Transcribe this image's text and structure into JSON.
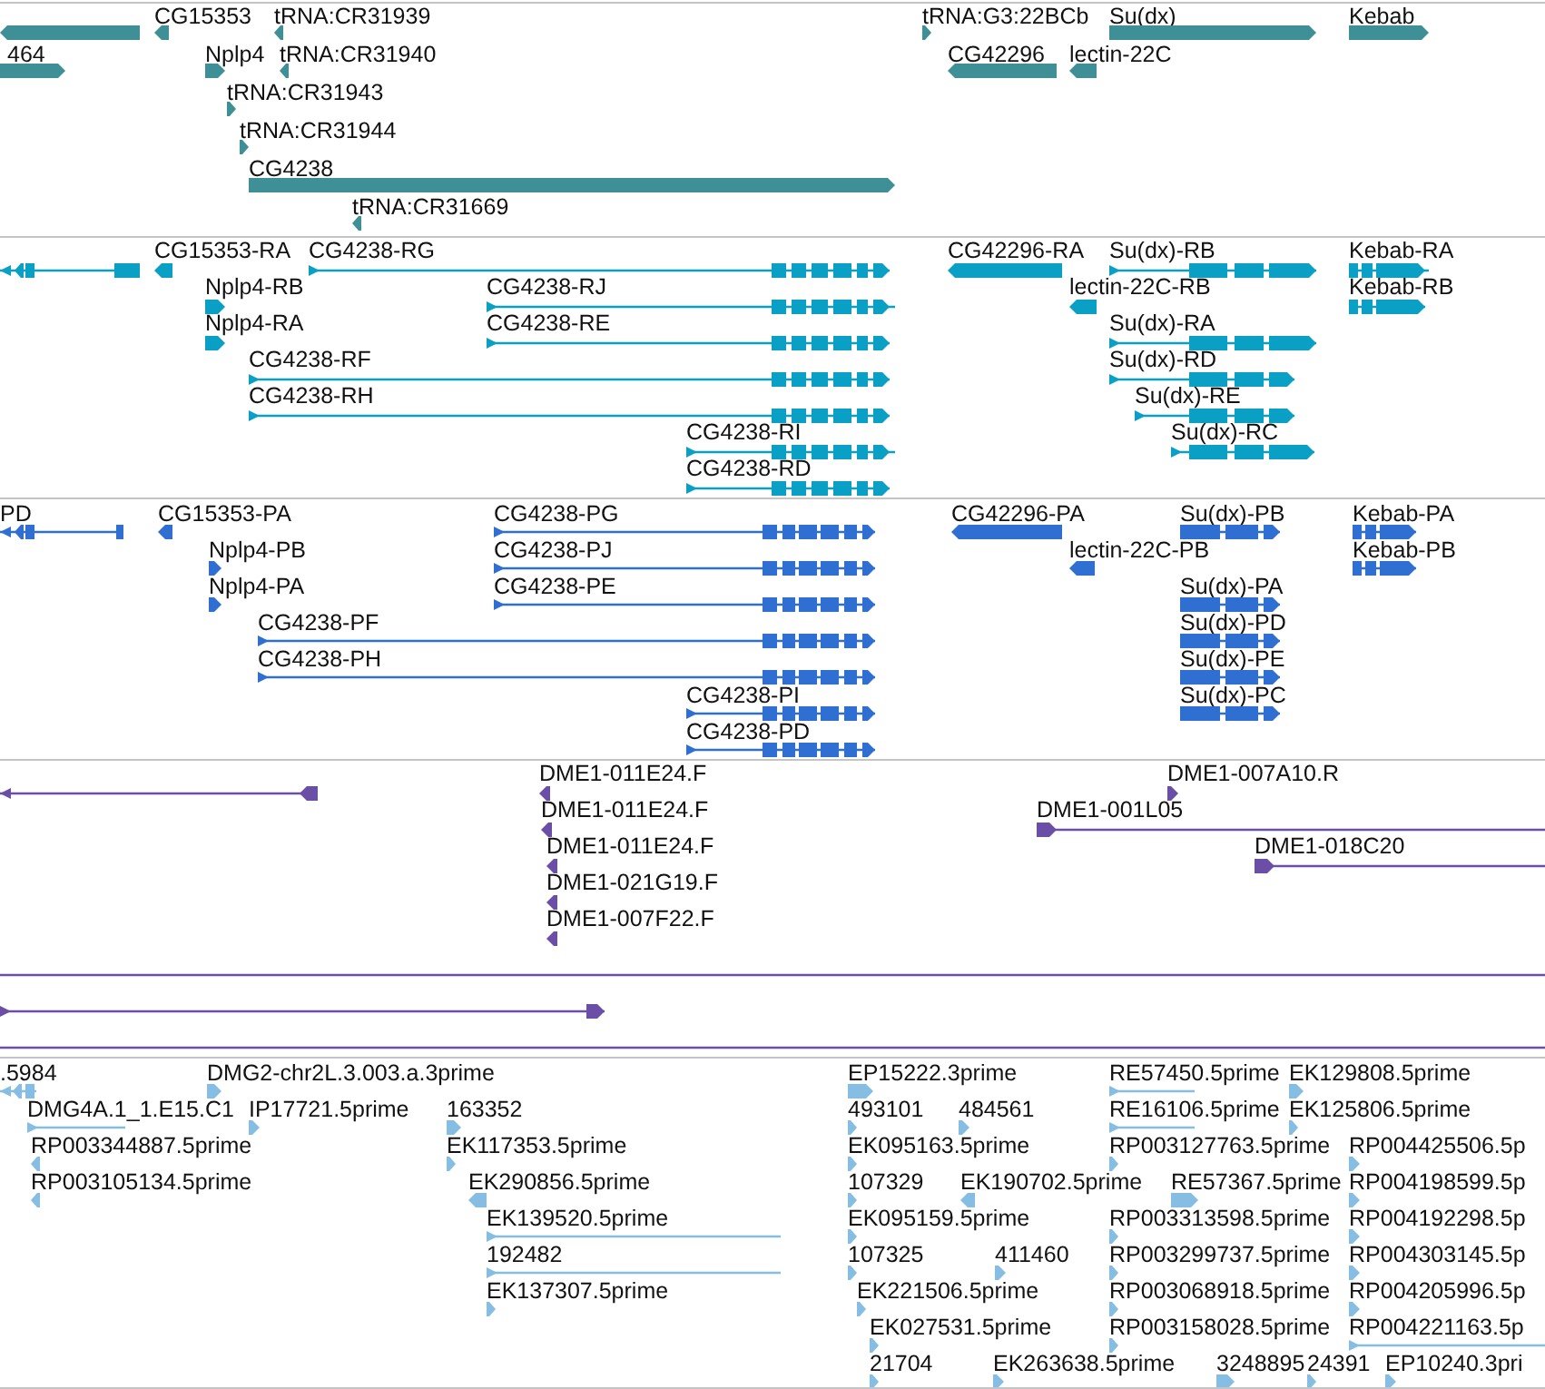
{
  "tracks": [
    {
      "color": "#3f9096",
      "features": [
        {
          "kind": "block",
          "reverse": true
        },
        {
          "label": "CG15353",
          "kind": "block",
          "reverse": true
        },
        {
          "label": "tRNA:CR31939",
          "kind": "block",
          "reverse": true
        },
        {
          "label": "tRNA:G3:22BCb",
          "kind": "block",
          "reverse": false
        },
        {
          "label": "Su(dx)",
          "kind": "block",
          "reverse": false
        },
        {
          "label": "Kebab",
          "kind": "block",
          "reverse": false
        },
        {
          "label": "464",
          "kind": "block",
          "reverse": false
        },
        {
          "label": "Nplp4",
          "kind": "block",
          "reverse": false
        },
        {
          "label": "tRNA:CR31940",
          "kind": "block",
          "reverse": true
        },
        {
          "label": "CG42296",
          "kind": "block",
          "reverse": true
        },
        {
          "label": "lectin-22C",
          "kind": "block",
          "reverse": true
        },
        {
          "label": "tRNA:CR31943",
          "kind": "block",
          "reverse": false
        },
        {
          "label": "tRNA:CR31944",
          "kind": "block",
          "reverse": false
        },
        {
          "label": "CG4238",
          "kind": "block",
          "reverse": false
        },
        {
          "label": "tRNA:CR31669",
          "kind": "block",
          "reverse": true
        }
      ]
    },
    {
      "color": "#0a9fc4",
      "features": [
        {
          "kind": "spliced",
          "reverse": true
        },
        {
          "label": "CG15353-RA",
          "kind": "block",
          "reverse": true
        },
        {
          "label": "CG4238-RG",
          "kind": "spliced",
          "reverse": false
        },
        {
          "label": "CG42296-RA",
          "kind": "block",
          "reverse": true
        },
        {
          "label": "Su(dx)-RB",
          "kind": "spliced",
          "reverse": false
        },
        {
          "label": "Kebab-RA",
          "kind": "spliced",
          "reverse": false
        },
        {
          "label": "Nplp4-RB",
          "kind": "block",
          "reverse": false
        },
        {
          "label": "CG4238-RJ",
          "kind": "spliced",
          "reverse": false
        },
        {
          "label": "lectin-22C-RB",
          "kind": "block",
          "reverse": true
        },
        {
          "label": "Kebab-RB",
          "kind": "spliced",
          "reverse": false
        },
        {
          "label": "Nplp4-RA",
          "kind": "block",
          "reverse": false
        },
        {
          "label": "CG4238-RE",
          "kind": "spliced",
          "reverse": false
        },
        {
          "label": "Su(dx)-RA",
          "kind": "spliced",
          "reverse": false
        },
        {
          "label": "CG4238-RF",
          "kind": "spliced",
          "reverse": false
        },
        {
          "label": "Su(dx)-RD",
          "kind": "spliced",
          "reverse": false
        },
        {
          "label": "CG4238-RH",
          "kind": "spliced",
          "reverse": false
        },
        {
          "label": "Su(dx)-RE",
          "kind": "spliced",
          "reverse": false
        },
        {
          "label": "CG4238-RI",
          "kind": "spliced",
          "reverse": false
        },
        {
          "label": "Su(dx)-RC",
          "kind": "spliced",
          "reverse": false
        },
        {
          "label": "CG4238-RD",
          "kind": "spliced",
          "reverse": false
        }
      ]
    },
    {
      "color": "#2f6fd1",
      "features": [
        {
          "label": "PD",
          "kind": "spliced",
          "reverse": true
        },
        {
          "label": "CG15353-PA",
          "kind": "block",
          "reverse": true
        },
        {
          "label": "CG4238-PG",
          "kind": "spliced",
          "reverse": false
        },
        {
          "label": "CG42296-PA",
          "kind": "block",
          "reverse": true
        },
        {
          "label": "Su(dx)-PB",
          "kind": "spliced",
          "reverse": false
        },
        {
          "label": "Kebab-PA",
          "kind": "spliced",
          "reverse": false
        },
        {
          "label": "Nplp4-PB",
          "kind": "block",
          "reverse": false
        },
        {
          "label": "CG4238-PJ",
          "kind": "spliced",
          "reverse": false
        },
        {
          "label": "lectin-22C-PB",
          "kind": "block",
          "reverse": true
        },
        {
          "label": "Kebab-PB",
          "kind": "spliced",
          "reverse": false
        },
        {
          "label": "Nplp4-PA",
          "kind": "block",
          "reverse": false
        },
        {
          "label": "CG4238-PE",
          "kind": "spliced",
          "reverse": false
        },
        {
          "label": "Su(dx)-PA",
          "kind": "spliced",
          "reverse": false
        },
        {
          "label": "CG4238-PF",
          "kind": "spliced",
          "reverse": false
        },
        {
          "label": "Su(dx)-PD",
          "kind": "spliced",
          "reverse": false
        },
        {
          "label": "CG4238-PH",
          "kind": "spliced",
          "reverse": false
        },
        {
          "label": "Su(dx)-PE",
          "kind": "spliced",
          "reverse": false
        },
        {
          "label": "CG4238-PI",
          "kind": "spliced",
          "reverse": false
        },
        {
          "label": "Su(dx)-PC",
          "kind": "spliced",
          "reverse": false
        },
        {
          "label": "CG4238-PD",
          "kind": "spliced",
          "reverse": false
        }
      ]
    },
    {
      "color": "#6b4fa6",
      "features": [
        {
          "kind": "spliced",
          "reverse": true
        },
        {
          "label": "DME1-011E24.F",
          "kind": "block",
          "reverse": true
        },
        {
          "label": "DME1-007A10.R",
          "kind": "block",
          "reverse": false
        },
        {
          "label": "DME1-011E24.F",
          "kind": "block",
          "reverse": true
        },
        {
          "label": "DME1-001L05",
          "kind": "spliced",
          "reverse": false
        },
        {
          "label": "DME1-011E24.F",
          "kind": "block",
          "reverse": true
        },
        {
          "label": "DME1-018C20",
          "kind": "spliced",
          "reverse": false
        },
        {
          "label": "DME1-021G19.F",
          "kind": "block",
          "reverse": true
        },
        {
          "label": "DME1-007F22.F",
          "kind": "block",
          "reverse": true
        },
        {
          "kind": "spliced"
        },
        {
          "kind": "spliced",
          "reverse": false
        },
        {
          "kind": "spliced"
        }
      ]
    },
    {
      "color": "#85bde3",
      "features": [
        {
          "label": ".5984",
          "kind": "spliced",
          "reverse": true
        },
        {
          "label": "DMG2-chr2L.3.003.a.3prime",
          "kind": "block",
          "reverse": false
        },
        {
          "label": "EP15222.3prime",
          "kind": "block",
          "reverse": false
        },
        {
          "label": "RE57450.5prime",
          "kind": "spliced",
          "reverse": false
        },
        {
          "label": "EK129808.5prime",
          "kind": "block",
          "reverse": false
        },
        {
          "label": "DMG4A.1_1.E15.C1",
          "kind": "spliced",
          "reverse": false
        },
        {
          "label": "IP17721.5prime",
          "kind": "block",
          "reverse": false
        },
        {
          "label": "163352",
          "kind": "block",
          "reverse": false
        },
        {
          "label": "493101",
          "kind": "block",
          "reverse": false
        },
        {
          "label": "484561",
          "kind": "block",
          "reverse": false
        },
        {
          "label": "RE16106.5prime",
          "kind": "spliced",
          "reverse": false
        },
        {
          "label": "EK125806.5prime",
          "kind": "block",
          "reverse": false
        },
        {
          "label": "RP003344887.5prime",
          "kind": "block",
          "reverse": true
        },
        {
          "label": "EK117353.5prime",
          "kind": "block",
          "reverse": false
        },
        {
          "label": "EK095163.5prime",
          "kind": "block",
          "reverse": false
        },
        {
          "label": "RP003127763.5prime",
          "kind": "block",
          "reverse": false
        },
        {
          "label": "RP004425506.5p",
          "kind": "block",
          "reverse": false
        },
        {
          "label": "RP003105134.5prime",
          "kind": "block",
          "reverse": true
        },
        {
          "label": "EK290856.5prime",
          "kind": "block",
          "reverse": true
        },
        {
          "label": "107329",
          "kind": "block",
          "reverse": false
        },
        {
          "label": "EK190702.5prime",
          "kind": "block",
          "reverse": true
        },
        {
          "label": "RE57367.5prime",
          "kind": "block",
          "reverse": false
        },
        {
          "label": "RP004198599.5p",
          "kind": "block",
          "reverse": false
        },
        {
          "label": "EK139520.5prime",
          "kind": "spliced",
          "reverse": false
        },
        {
          "label": "EK095159.5prime",
          "kind": "block",
          "reverse": false
        },
        {
          "label": "RP003313598.5prime",
          "kind": "block",
          "reverse": false
        },
        {
          "label": "RP004192298.5p",
          "kind": "block",
          "reverse": false
        },
        {
          "label": "192482",
          "kind": "spliced",
          "reverse": false
        },
        {
          "label": "107325",
          "kind": "block",
          "reverse": false
        },
        {
          "label": "411460",
          "kind": "block",
          "reverse": false
        },
        {
          "label": "RP003299737.5prime",
          "kind": "block",
          "reverse": false
        },
        {
          "label": "RP004303145.5p",
          "kind": "block",
          "reverse": false
        },
        {
          "label": "EK137307.5prime",
          "kind": "block",
          "reverse": false
        },
        {
          "label": "EK221506.5prime",
          "kind": "block",
          "reverse": false
        },
        {
          "label": "RP003068918.5prime",
          "kind": "block",
          "reverse": false
        },
        {
          "label": "RP004205996.5p",
          "kind": "block",
          "reverse": false
        },
        {
          "label": "EK027531.5prime",
          "kind": "block",
          "reverse": false
        },
        {
          "label": "RP003158028.5prime",
          "kind": "block",
          "reverse": false
        },
        {
          "label": "RP004221163.5p",
          "kind": "spliced",
          "reverse": false
        },
        {
          "label": "21704",
          "kind": "block",
          "reverse": false
        },
        {
          "label": "EK263638.5prime",
          "kind": "block",
          "reverse": false
        },
        {
          "label": "3248895",
          "kind": "block",
          "reverse": false
        },
        {
          "label": "24391",
          "kind": "block",
          "reverse": false
        },
        {
          "label": "EP10240.3pri",
          "kind": "block",
          "reverse": false
        }
      ]
    }
  ]
}
